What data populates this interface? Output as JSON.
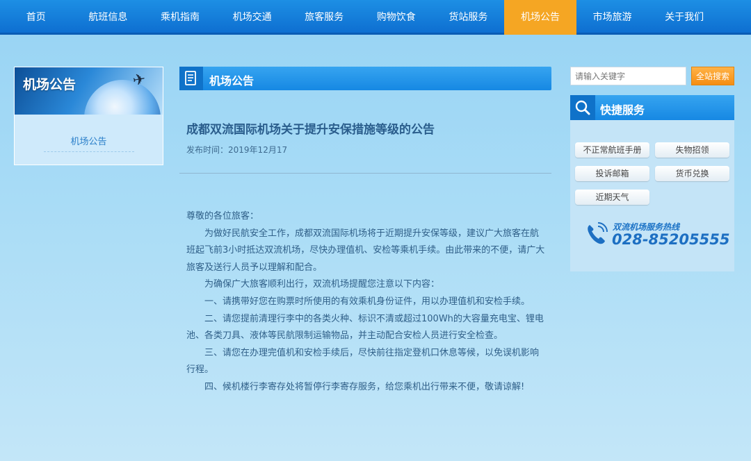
{
  "nav": {
    "items": [
      "首页",
      "航班信息",
      "乘机指南",
      "机场交通",
      "旅客服务",
      "购物饮食",
      "货站服务",
      "机场公告",
      "市场旅游",
      "关于我们"
    ],
    "active_index": 7,
    "active_color": "#f5a623"
  },
  "sidebar": {
    "banner_title": "机场公告",
    "link_label": "机场公告"
  },
  "section": {
    "title": "机场公告"
  },
  "article": {
    "title": "成都双流国际机场关于提升安保措施等级的公告",
    "pub_label": "发布时间：",
    "pub_date": "2019年12月17",
    "paragraphs": [
      "尊敬的各位旅客：",
      "为做好民航安全工作，成都双流国际机场将于近期提升安保等级，建议广大旅客在航班起飞前3小时抵达双流机场，尽快办理值机、安检等乘机手续。由此带来的不便，请广大旅客及送行人员予以理解和配合。",
      "为确保广大旅客顺利出行，双流机场提醒您注意以下内容：",
      "一、请携带好您在购票时所使用的有效乘机身份证件，用以办理值机和安检手续。",
      "二、请您提前清理行李中的各类火种、标识不清或超过100Wh的大容量充电宝、锂电池、各类刀具、液体等民航限制运输物品，并主动配合安检人员进行安全检查。",
      "三、请您在办理完值机和安检手续后，尽快前往指定登机口休息等候，以免误机影响行程。",
      "四、候机楼行李寄存处将暂停行李寄存服务，给您乘机出行带来不便，敬请谅解!"
    ]
  },
  "search": {
    "placeholder": "请输入关键字",
    "button_label": "全站搜索"
  },
  "quick_service": {
    "title": "快捷服务",
    "buttons": [
      "不正常航班手册",
      "失物招领",
      "投诉邮箱",
      "货币兑换",
      "近期天气"
    ],
    "hotline_label": "双流机场服务热线",
    "hotline_number": "028-85205555"
  },
  "icons": [
    "document-icon",
    "search-icon",
    "phone-icon",
    "airplane-icon",
    "globe-icon"
  ]
}
